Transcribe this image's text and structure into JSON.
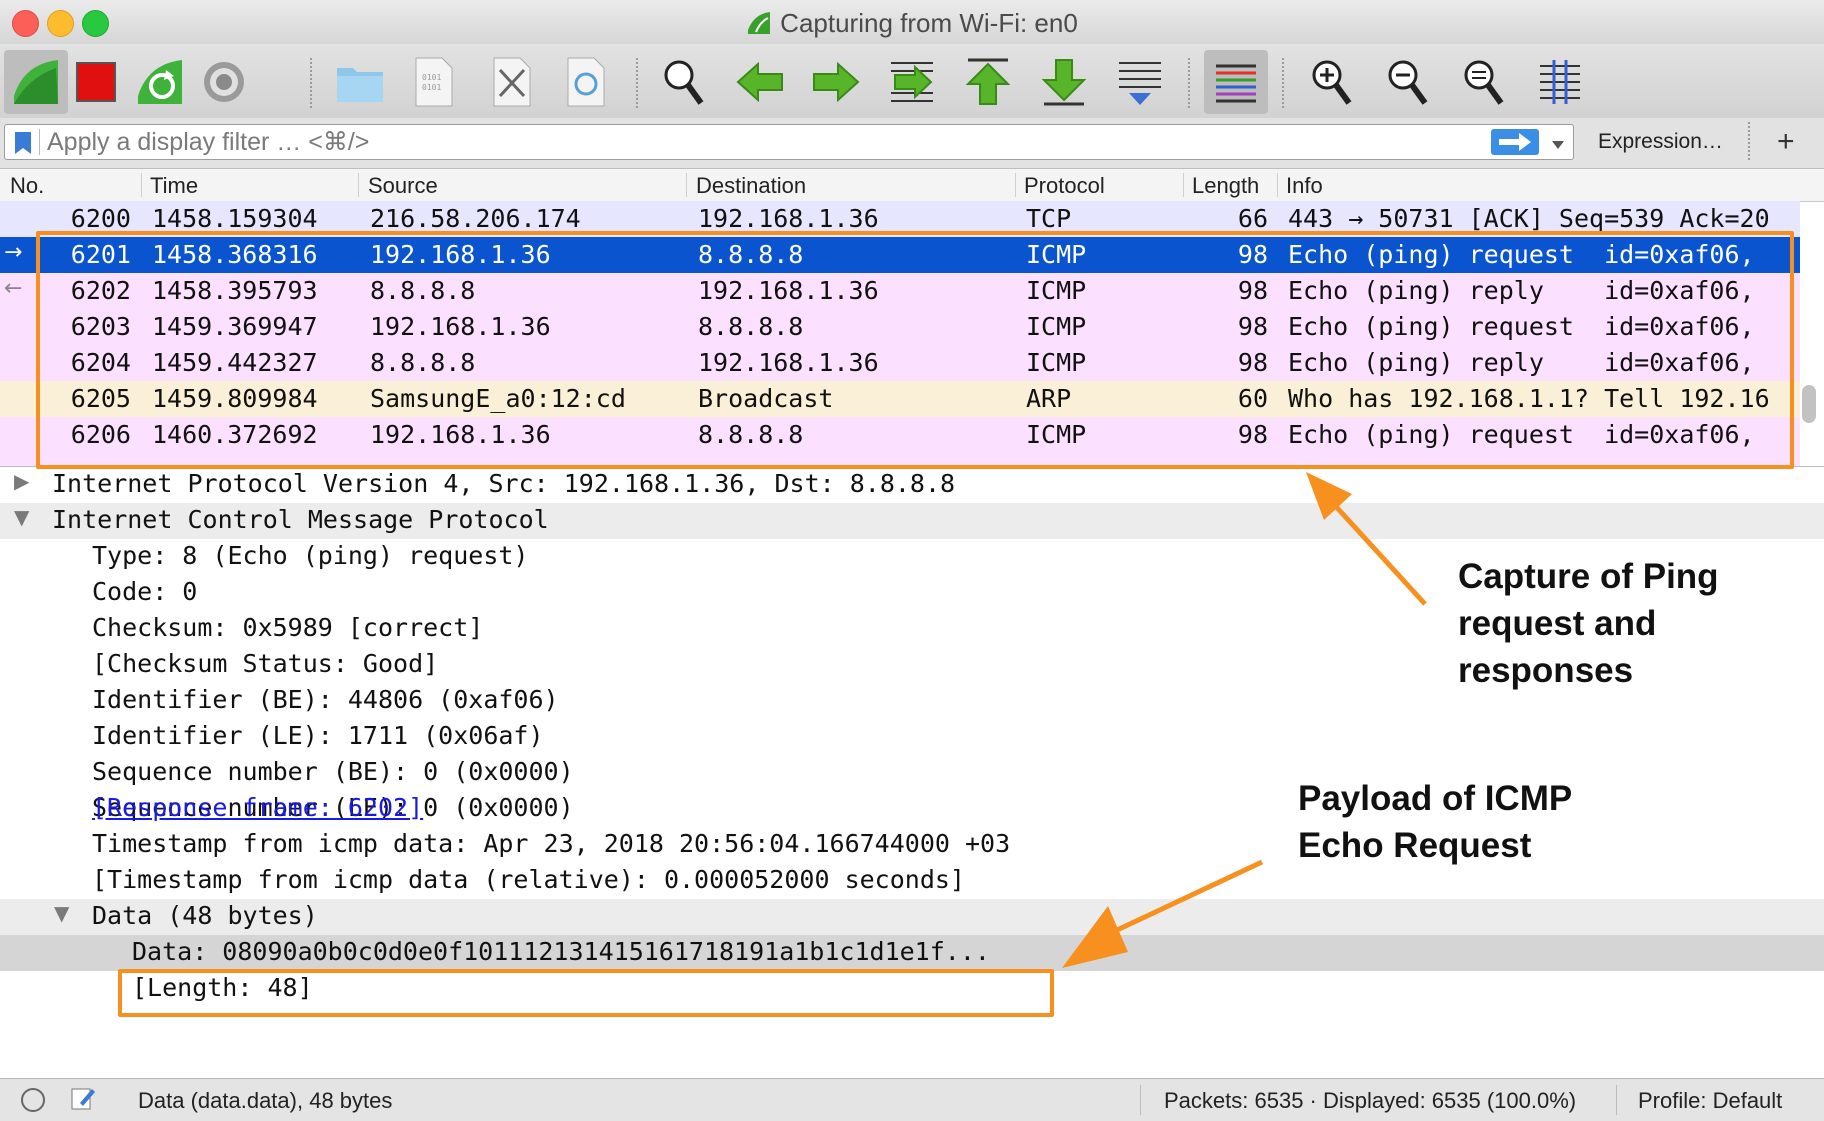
{
  "window": {
    "title": "Capturing from Wi-Fi: en0",
    "traffic_colors": [
      "#fc5f57",
      "#fdbc2e",
      "#28c840"
    ]
  },
  "toolbar": {
    "buttons": [
      "shark-fin-start-icon",
      "stop-capture-icon",
      "restart-capture-icon",
      "capture-options-icon",
      "open-file-icon",
      "save-file-icon",
      "close-file-icon",
      "reload-file-icon",
      "find-packet-icon",
      "go-back-icon",
      "go-forward-icon",
      "go-to-packet-icon",
      "go-first-icon",
      "go-last-icon",
      "auto-scroll-icon",
      "colorize-icon",
      "zoom-in-icon",
      "zoom-out-icon",
      "zoom-normal-icon",
      "resize-columns-icon"
    ]
  },
  "filter": {
    "placeholder": "Apply a display filter … <⌘/>",
    "expression_label": "Expression…",
    "plus_label": "+"
  },
  "packet_list": {
    "columns": [
      "No.",
      "Time",
      "Source",
      "Destination",
      "Protocol",
      "Length",
      "Info"
    ],
    "rows": [
      {
        "no": "6200",
        "time": "1458.159304",
        "source": "216.58.206.174",
        "destination": "192.168.1.36",
        "protocol": "TCP",
        "length": "66",
        "info": "443 → 50731 [ACK] Seq=539 Ack=20",
        "bg": "#e7e6ff",
        "selected": false,
        "marker": ""
      },
      {
        "no": "6201",
        "time": "1458.368316",
        "source": "192.168.1.36",
        "destination": "8.8.8.8",
        "protocol": "ICMP",
        "length": "98",
        "info": "Echo (ping) request  id=0xaf06,",
        "bg": "#0a55cf",
        "selected": true,
        "marker": "→"
      },
      {
        "no": "6202",
        "time": "1458.395793",
        "source": "8.8.8.8",
        "destination": "192.168.1.36",
        "protocol": "ICMP",
        "length": "98",
        "info": "Echo (ping) reply    id=0xaf06,",
        "bg": "#fce0ff",
        "selected": false,
        "marker": "←"
      },
      {
        "no": "6203",
        "time": "1459.369947",
        "source": "192.168.1.36",
        "destination": "8.8.8.8",
        "protocol": "ICMP",
        "length": "98",
        "info": "Echo (ping) request  id=0xaf06,",
        "bg": "#fce0ff",
        "selected": false,
        "marker": ""
      },
      {
        "no": "6204",
        "time": "1459.442327",
        "source": "8.8.8.8",
        "destination": "192.168.1.36",
        "protocol": "ICMP",
        "length": "98",
        "info": "Echo (ping) reply    id=0xaf06,",
        "bg": "#fce0ff",
        "selected": false,
        "marker": ""
      },
      {
        "no": "6205",
        "time": "1459.809984",
        "source": "SamsungE_a0:12:cd",
        "destination": "Broadcast",
        "protocol": "ARP",
        "length": "60",
        "info": "Who has 192.168.1.1? Tell 192.16",
        "bg": "#faf0d7",
        "selected": false,
        "marker": ""
      },
      {
        "no": "6206",
        "time": "1460.372692",
        "source": "192.168.1.36",
        "destination": "8.8.8.8",
        "protocol": "ICMP",
        "length": "98",
        "info": "Echo (ping) request  id=0xaf06,",
        "bg": "#fce0ff",
        "selected": false,
        "marker": ""
      }
    ]
  },
  "details": {
    "ip_line": "Internet Protocol Version 4, Src: 192.168.1.36, Dst: 8.8.8.8",
    "icmp_line": "Internet Control Message Protocol",
    "fields": [
      "Type: 8 (Echo (ping) request)",
      "Code: 0",
      "Checksum: 0x5989 [correct]",
      "[Checksum Status: Good]",
      "Identifier (BE): 44806 (0xaf06)",
      "Identifier (LE): 1711 (0x06af)",
      "Sequence number (BE): 0 (0x0000)",
      "Sequence number (LE): 0 (0x0000)"
    ],
    "response_link": "[Response frame: 6202]",
    "timestamp": "Timestamp from icmp data: Apr 23, 2018 20:56:04.166744000 +03",
    "timestamp_rel": "[Timestamp from icmp data (relative): 0.000052000 seconds]",
    "data_node": "Data (48 bytes)",
    "data_value": "Data: 08090a0b0c0d0e0f101112131415161718191a1b1c1d1e1f...",
    "data_length": "[Length: 48]"
  },
  "annotations": {
    "callout1": [
      "Capture of Ping",
      "request and",
      "responses"
    ],
    "callout2": [
      "Payload of ICMP",
      "Echo Request"
    ],
    "accent": "#f7901e"
  },
  "status": {
    "field": "Data (data.data), 48 bytes",
    "packets": "Packets: 6535 · Displayed: 6535 (100.0%)",
    "profile": "Profile: Default"
  }
}
